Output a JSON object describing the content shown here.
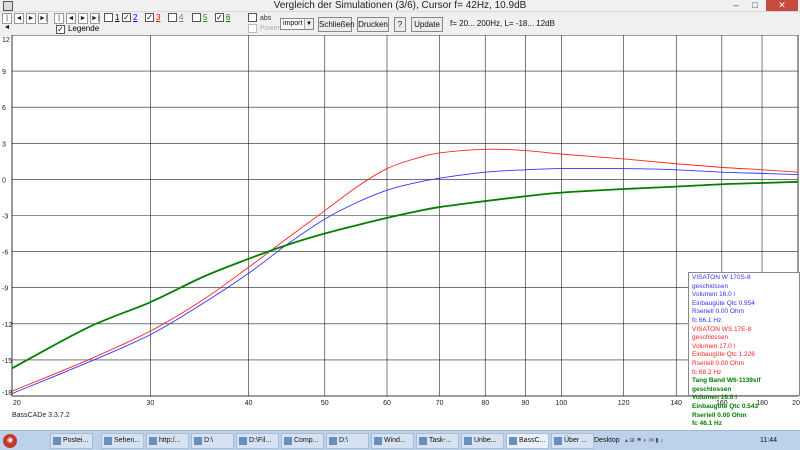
{
  "window": {
    "title": "Vergleich der Simulationen (3/6), Cursor f= 42Hz, 10.9dB",
    "min": "–",
    "max": "□",
    "close": "✕"
  },
  "toolbar": {
    "nav_buttons": [
      "|◄",
      "◄",
      "►",
      "►|",
      "|◄",
      "◄",
      "►",
      "►|"
    ],
    "checkboxes": [
      {
        "label": "1",
        "checked": false,
        "color": "#000000"
      },
      {
        "label": "2",
        "checked": true,
        "color": "#0000ff"
      },
      {
        "label": "3",
        "checked": true,
        "color": "#ff0000"
      },
      {
        "label": "4",
        "checked": false,
        "color": "#808080"
      },
      {
        "label": "5",
        "checked": false,
        "color": "#00a000"
      },
      {
        "label": "6",
        "checked": true,
        "color": "#007000"
      }
    ],
    "legende_label": "Legende",
    "abs_label": "abs",
    "power_label": "Power",
    "select_value": "import",
    "schliessen_label": "Schließen",
    "drucken_label": "Drucken",
    "help_label": "?",
    "update_label": "Update",
    "info": "f=  20... 200Hz, L= -18... 12dB"
  },
  "chart_data": {
    "type": "line",
    "xlabel": "",
    "ylabel": "",
    "xlim": [
      20,
      200
    ],
    "ylim": [
      -18,
      12
    ],
    "xticks": [
      "20",
      "30",
      "40",
      "50",
      "60",
      "70",
      "80",
      "90",
      "100",
      "120",
      "140",
      "160",
      "180",
      "200"
    ],
    "yticks": [
      "12",
      "9",
      "6",
      "3",
      "0",
      "-3",
      "-6",
      "-9",
      "-12",
      "-15",
      "-18"
    ],
    "grid": true,
    "series": [
      {
        "name": "VISATON W 170S-8",
        "color": "#3333ff",
        "x": [
          20,
          25,
          30,
          35,
          40,
          45,
          50,
          55,
          60,
          65,
          70,
          80,
          90,
          100,
          120,
          140,
          160,
          180,
          200
        ],
        "y": [
          -17.8,
          -15.2,
          -12.9,
          -10.3,
          -7.8,
          -5.3,
          -3.3,
          -1.9,
          -0.9,
          -0.3,
          0.1,
          0.6,
          0.8,
          0.9,
          0.9,
          0.8,
          0.6,
          0.5,
          0.4
        ]
      },
      {
        "name": "VISATON WS 17E-8",
        "color": "#ff2222",
        "x": [
          20,
          25,
          30,
          35,
          40,
          45,
          50,
          55,
          60,
          65,
          70,
          80,
          90,
          100,
          120,
          140,
          160,
          180,
          200
        ],
        "y": [
          -17.6,
          -15.0,
          -12.6,
          -10.0,
          -7.3,
          -4.8,
          -2.6,
          -0.6,
          0.9,
          1.7,
          2.2,
          2.5,
          2.4,
          2.1,
          1.7,
          1.3,
          1.0,
          0.8,
          0.6
        ]
      },
      {
        "name": "Tang Band W6-1139sif",
        "color": "#008000",
        "x": [
          20,
          25,
          30,
          35,
          40,
          45,
          50,
          55,
          60,
          65,
          70,
          80,
          90,
          100,
          120,
          140,
          160,
          180,
          200
        ],
        "y": [
          -15.7,
          -12.3,
          -10.2,
          -8.1,
          -6.6,
          -5.4,
          -4.5,
          -3.8,
          -3.2,
          -2.7,
          -2.3,
          -1.8,
          -1.4,
          -1.1,
          -0.8,
          -0.6,
          -0.4,
          -0.3,
          -0.2
        ]
      }
    ],
    "legend": [
      {
        "color": "#3333ff",
        "bold": false,
        "lines": [
          "VISATON W 170S-8",
          "geschlossen",
          "Volumen 16.0 l",
          "Einbaugüte Qtc 0.954",
          "Rseriell 0.00 Ohm",
          "fc 66.1 Hz"
        ]
      },
      {
        "color": "#ff2222",
        "bold": false,
        "lines": [
          "VISATON WS 17E-8",
          "geschlossen",
          "Volumen 17.0 l",
          "Einbaugüte Qtc 1.226",
          "Rseriell 0.00 Ohm",
          "fc 68.2 Hz"
        ]
      },
      {
        "color": "#008000",
        "bold": true,
        "lines": [
          "Tang Band W6-1139sif",
          "geschlossen",
          "Volumen 16.0 l",
          "Einbaugüte Qtc 0.543",
          "Rseriell 0.00 Ohm",
          "fc 46.1 Hz"
        ]
      }
    ],
    "legend_position": "bottom-right"
  },
  "version_label": "BassCADe 3.3.7.2",
  "taskbar": {
    "items": [
      "Postei...",
      "Sehen...",
      "http:/...",
      "D:\\",
      "D:\\Fil...",
      "Comp...",
      "D:\\",
      "Wind...",
      "Task-...",
      "Unbe...",
      "BassC...",
      "Über ..."
    ],
    "active_index": 10,
    "desktop_label": "Desktop",
    "time": "11:44"
  }
}
